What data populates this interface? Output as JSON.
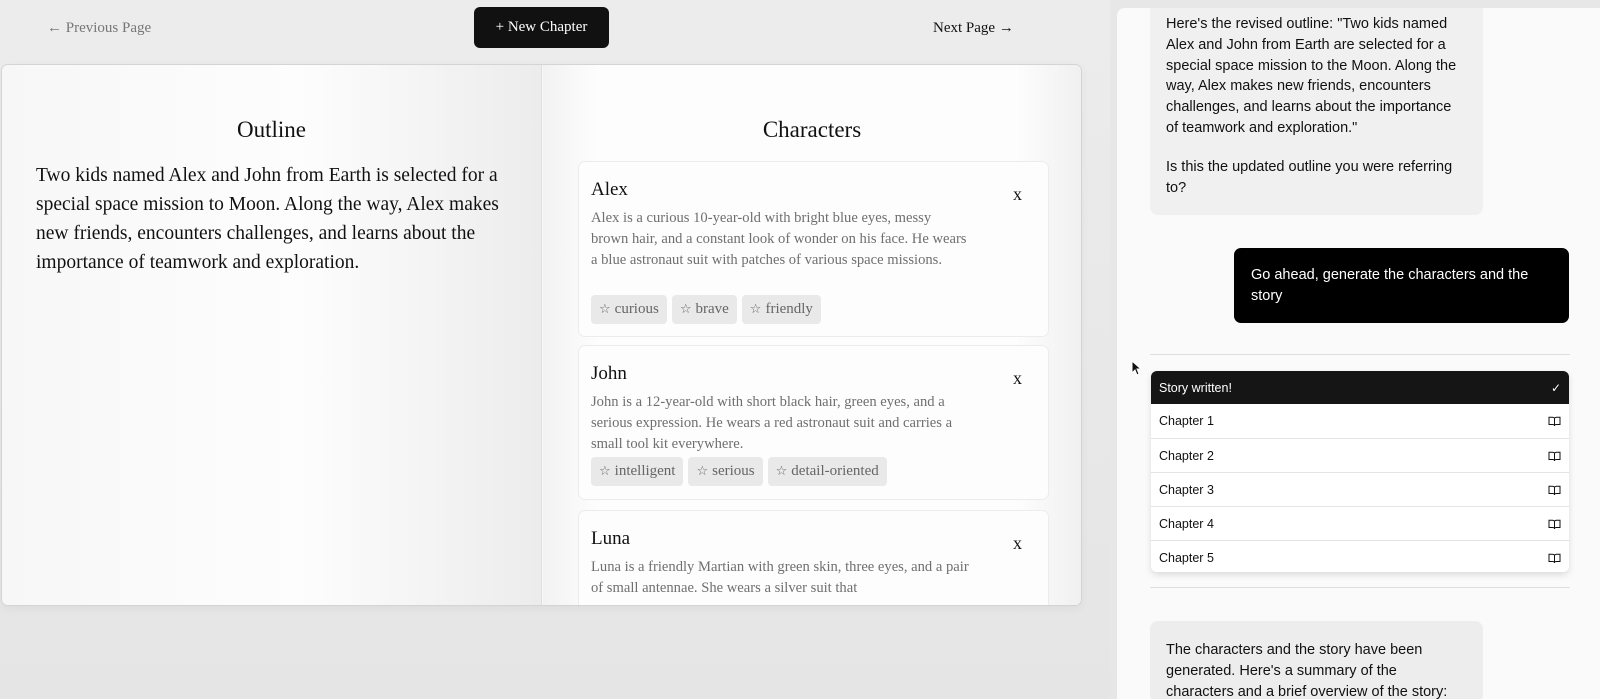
{
  "topnav": {
    "previous_label": "← Previous Page",
    "new_chapter_label": "+ New Chapter",
    "next_label": "Next Page →"
  },
  "outline": {
    "title": "Outline",
    "text": "Two kids named Alex and John from Earth is selected for a special space mission to Moon. Along the way, Alex makes new friends, encounters challenges, and learns about the importance of teamwork and exploration."
  },
  "characters": {
    "title": "Characters",
    "items": [
      {
        "name": "Alex",
        "remove_label": "x",
        "description": "Alex is a curious 10-year-old with bright blue eyes, messy brown hair, and a constant look of wonder on his face. He wears a blue astronaut suit with patches of various space missions.",
        "traits": [
          "curious",
          "brave",
          "friendly"
        ]
      },
      {
        "name": "John",
        "remove_label": "x",
        "description": "John is a 12-year-old with short black hair, green eyes, and a serious expression. He wears a red astronaut suit and carries a small tool kit everywhere.",
        "traits": [
          "intelligent",
          "serious",
          "detail-oriented"
        ]
      },
      {
        "name": "Luna",
        "remove_label": "x",
        "description": "Luna is a friendly Martian with green skin, three eyes, and a pair of small antennae. She wears a silver suit that"
      }
    ]
  },
  "chat": {
    "assistant_first_paragraph": "Here's the revised outline: \"Two kids named Alex and John from Earth are selected for a special space mission to the Moon. Along the way, Alex makes new friends, encounters challenges, and learns about the importance of teamwork and exploration.\"",
    "assistant_first_question": "Is this the updated outline you were referring to?",
    "user_message": "Go ahead, generate the characters and the story",
    "story_header": "Story written!",
    "chapters": [
      "Chapter 1",
      "Chapter 2",
      "Chapter 3",
      "Chapter 4",
      "Chapter 5"
    ],
    "assistant_final_message": "The characters and the story have been generated. Here's a summary of the characters and a brief overview of the story:"
  },
  "icons": {
    "trait": "star-icon",
    "chapter": "book-icon",
    "story_status": "check-icon"
  },
  "colors": {
    "primary_dark": "#111111",
    "background": "#e7e7e7",
    "muted_text": "#6f6f6f"
  }
}
